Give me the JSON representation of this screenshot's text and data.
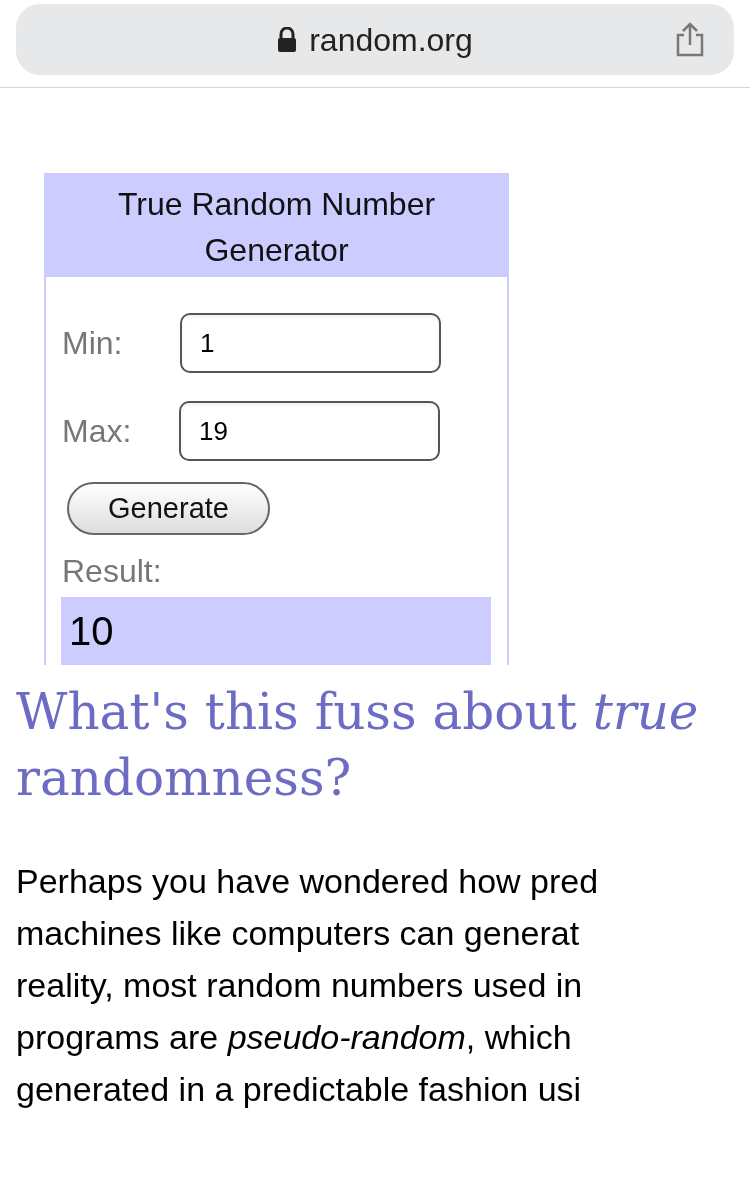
{
  "address_bar": {
    "url": "random.org",
    "secure": true
  },
  "widget": {
    "title": "True Random Number Generator",
    "min_label": "Min:",
    "min_value": "1",
    "max_label": "Max:",
    "max_value": "19",
    "button": "Generate",
    "result_label": "Result:",
    "result": "10"
  },
  "heading": {
    "text": "What's this fuss about *true*",
    "line_2": "randomness?"
  },
  "paragraph_lines": [
    "Perhaps you have wondered how pred",
    "machines like computers can generat",
    "reality, most random numbers used in",
    "programs are *pseudo-random*, which",
    "generated in a predictable fashion usi"
  ]
}
